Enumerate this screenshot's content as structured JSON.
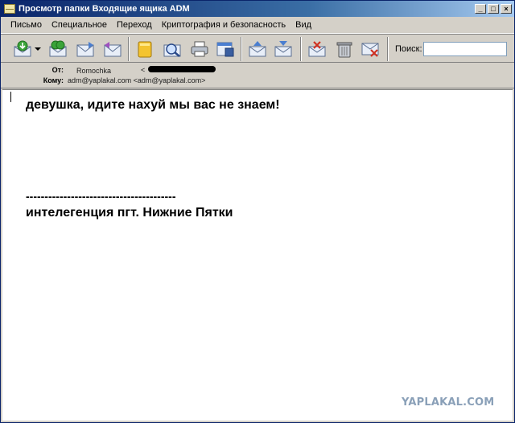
{
  "window": {
    "title": "Просмотр папки Входящие ящика ADM",
    "buttons": [
      "_",
      "□",
      "×"
    ]
  },
  "menu": {
    "items": [
      "Письмо",
      "Специальное",
      "Переход",
      "Криптография и безопасность",
      "Вид"
    ]
  },
  "toolbar": {
    "search_label": "Поиск:",
    "search_value": ""
  },
  "header": {
    "from_label": "От:",
    "from_value": "Romochka",
    "from_addr_prefix": "<",
    "to_label": "Кому:",
    "to_value": "adm@yaplakal.com <adm@yaplakal.com>"
  },
  "body": {
    "line1": "девушка, идите нахуй мы вас не знаем!",
    "separator": "----------------------------------------",
    "signature": "интелегенция пгт. Нижние Пятки"
  },
  "watermark": "YAPLAKAL.COM"
}
